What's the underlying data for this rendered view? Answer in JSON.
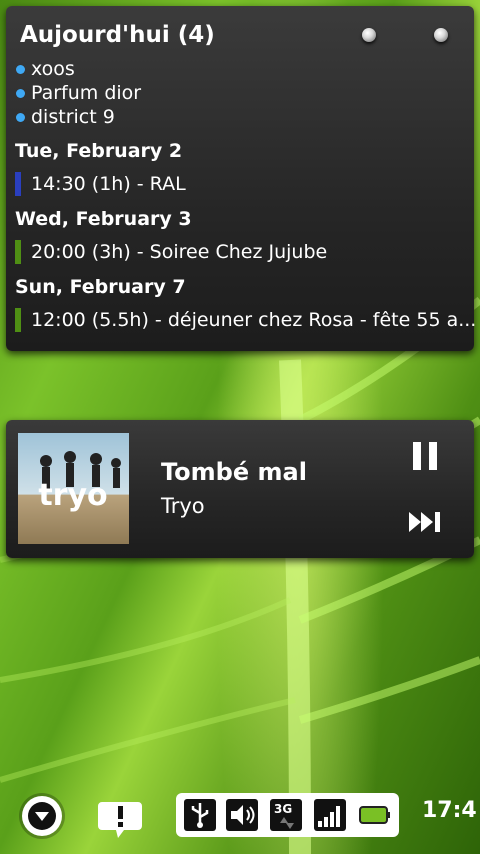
{
  "calendar": {
    "title": "Aujourd'hui (4)",
    "tasks": [
      "xoos",
      "Parfum dior",
      "district 9"
    ],
    "days": [
      {
        "date": "Tue, February 2",
        "event": "14:30 (1h) - RAL",
        "color": "#2a3fbf"
      },
      {
        "date": "Wed, February 3",
        "event": "20:00 (3h) - Soiree Chez Jujube",
        "color": "#4f8f14"
      },
      {
        "date": "Sun, February 7",
        "event": "12:00 (5.5h) - déjeuner chez Rosa - fête 55 a...",
        "color": "#4f8f14"
      }
    ]
  },
  "music": {
    "song": "Tombé mal",
    "artist": "Tryo",
    "album_art_text": "tryo"
  },
  "statusbar": {
    "clock": "17:4",
    "network": "3G",
    "battery_color": "#7ac025"
  },
  "icons": [
    "notification-down-icon",
    "alert-icon",
    "usb-icon",
    "volume-icon",
    "3g-data-icon",
    "signal-icon",
    "battery-icon",
    "pause-icon",
    "next-icon"
  ]
}
